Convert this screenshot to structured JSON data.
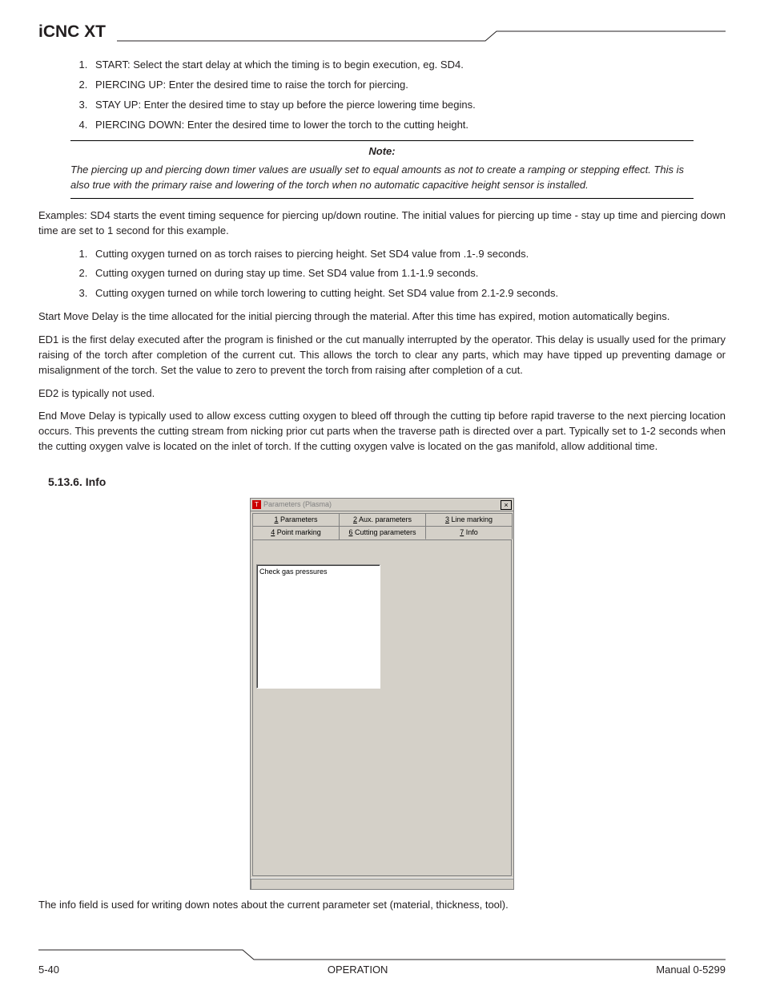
{
  "header": {
    "title": "iCNC XT"
  },
  "list_a": [
    "START: Select the start delay at which the timing is to begin execution, eg. SD4.",
    "PIERCING UP: Enter the desired time to raise the torch for piercing.",
    "STAY UP: Enter the desired time to stay up before the pierce lowering time begins.",
    "PIERCING DOWN: Enter the desired time to lower the torch to the cutting height."
  ],
  "note": {
    "label": "Note:",
    "body": "The piercing up and piercing down timer values are usually set to equal amounts as not to create a ramping or stepping effect. This is also true with the primary raise and lowering of the torch when no automatic capacitive height sensor is installed."
  },
  "para1": "Examples: SD4 starts the event timing sequence for piercing up/down routine. The initial values for piercing up time - stay up time and piercing down time are set to 1 second for this example.",
  "list_b": [
    "Cutting oxygen turned on as torch raises to piercing height.  Set SD4 value from .1-.9 seconds.",
    "Cutting oxygen turned on during stay up time. Set SD4 value from 1.1-1.9 seconds.",
    "Cutting oxygen turned on while torch lowering to cutting height. Set SD4 value from 2.1-2.9 seconds."
  ],
  "para2": "Start Move Delay is the time allocated for the initial piercing through the material. After this time has expired, motion automatically begins.",
  "para3": "ED1 is the first delay executed after the program is finished or the cut manually interrupted by the operator. This delay is usually used for the primary raising of the torch after completion of the current cut. This allows the torch to clear any parts, which may have tipped up preventing damage or misalignment of the torch. Set the value to zero to prevent the torch from raising after completion of a cut.",
  "para4": "ED2 is typically not used.",
  "para5": "End Move Delay is typically used to allow excess cutting oxygen to bleed off through the cutting tip before rapid traverse to the next piercing location occurs. This prevents the cutting stream from nicking prior cut parts when the traverse path is directed over a part. Typically set to 1-2 seconds when the cutting oxygen valve is located on the inlet of torch. If the cutting oxygen valve is located on the gas manifold, allow additional time.",
  "section_heading": "5.13.6. Info",
  "ui": {
    "title": "Parameters (Plasma)",
    "close": "×",
    "tabs_row1": [
      {
        "key": "1",
        "label": "Parameters"
      },
      {
        "key": "2",
        "label": "Aux. parameters"
      },
      {
        "key": "3",
        "label": "Line marking"
      }
    ],
    "tabs_row2": [
      {
        "key": "4",
        "label": "Point marking"
      },
      {
        "key": "6",
        "label": "Cutting parameters"
      },
      {
        "key": "7",
        "label": "Info",
        "active": true
      }
    ],
    "textarea_value": "Check gas pressures"
  },
  "caption": "The info field is used for writing down notes about the current parameter set (material, thickness, tool).",
  "footer": {
    "left": "5-40",
    "center": "OPERATION",
    "right": "Manual 0-5299"
  }
}
